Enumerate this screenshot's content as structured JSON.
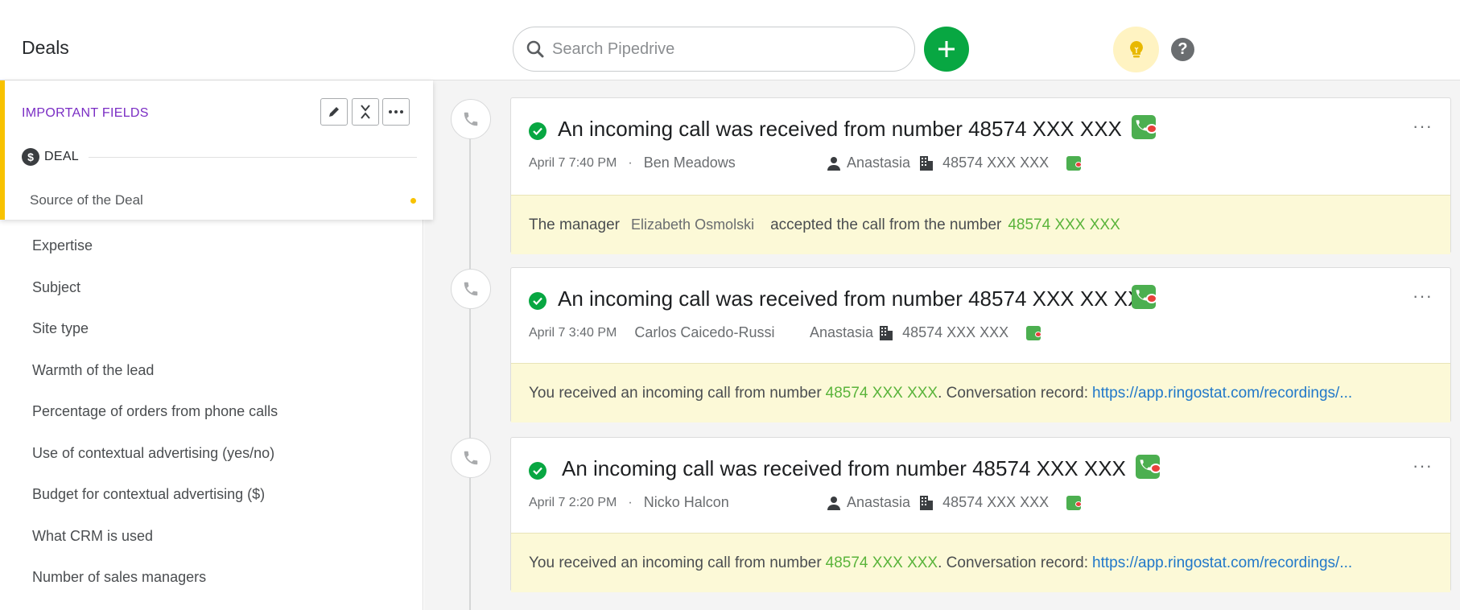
{
  "header": {
    "title": "Deals",
    "search_placeholder": "Search Pipedrive"
  },
  "important": {
    "title": "IMPORTANT FIELDS",
    "section_label": "DEAL",
    "section_icon": "dollar-icon",
    "source_field": "Source of the Deal"
  },
  "fields": [
    "Expertise",
    "Subject",
    "Site type",
    "Warmth of the lead",
    "Percentage of orders from phone calls",
    "Use of contextual advertising (yes/no)",
    "Budget for contextual advertising ($)",
    "What CRM is used",
    "Number of sales managers"
  ],
  "events": [
    {
      "title": "An incoming call was received from number 48574 XXX XXX",
      "date": "April 7 7:40 PM",
      "separator": "·",
      "contact": "Ben Meadows",
      "owner": "Anastasia",
      "number": "48574 XXX XXX",
      "note": {
        "prefix": "The manager",
        "manager": "Elizabeth Osmolski",
        "middle": "accepted the call from the number",
        "number": "48574 XXX XXX"
      }
    },
    {
      "title": "An incoming call was received from number 48574 XXX XX XX",
      "date": "April 7 3:40 PM",
      "contact": "Carlos Caicedo-Russi",
      "owner": "Anastasia",
      "number": "48574 XXX XXX",
      "note": {
        "prefix": "You received an incoming call from number",
        "number": "48574 XXX XXX",
        "middle": ". Conversation record:",
        "link": "https://app.ringostat.com/recordings/..."
      }
    },
    {
      "title": "An incoming call was received from number 48574 XXX XXX",
      "date": "April 7 2:20 PM",
      "separator": "·",
      "contact": "Nicko Halcon",
      "owner": "Anastasia",
      "number": "48574 XXX XXX",
      "note": {
        "prefix": "You received an incoming call from number",
        "number": "48574 XXX XXX",
        "middle": ". Conversation record:",
        "link": "https://app.ringostat.com/recordings/..."
      }
    }
  ],
  "more_label": "···",
  "help_label": "?",
  "colors": {
    "accent_green": "#08a742",
    "important_border": "#f8c200",
    "important_title": "#7a2dc4",
    "note_bg": "#fcf9d7",
    "link": "#2178c9",
    "number_green": "#5ab43b"
  }
}
